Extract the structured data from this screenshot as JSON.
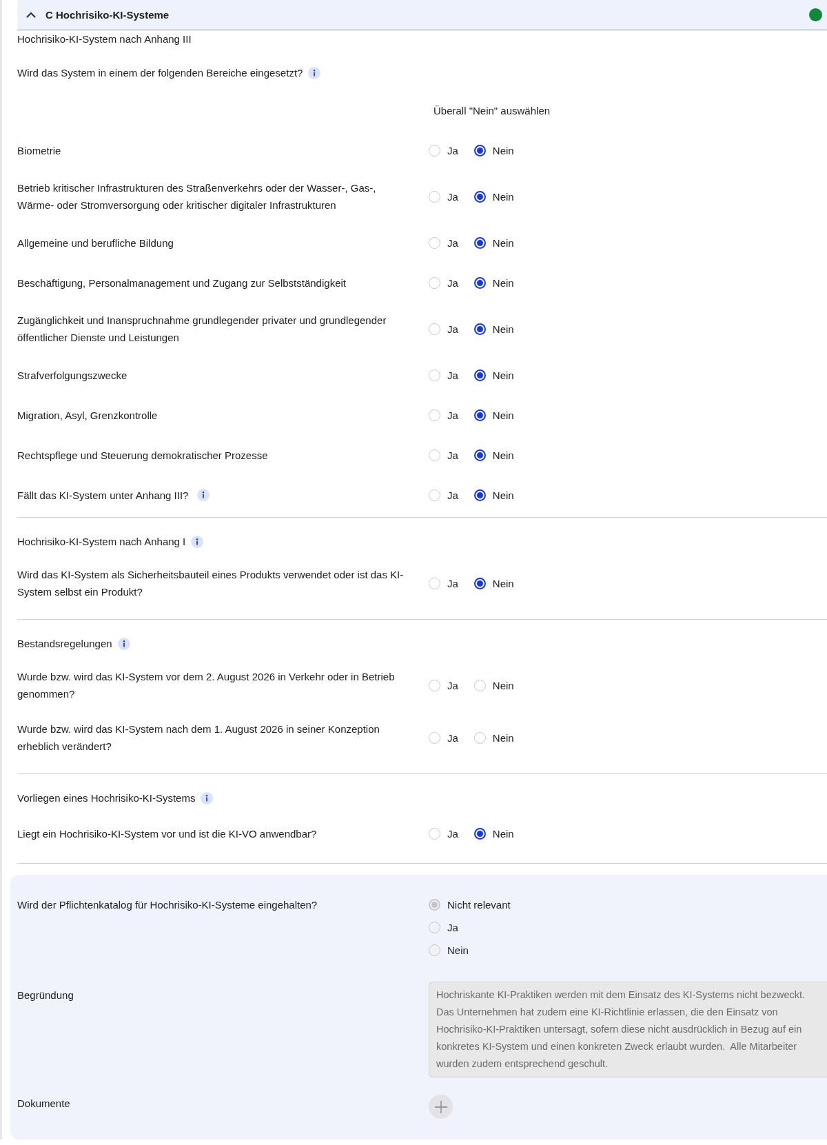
{
  "section": {
    "title": "C Hochrisiko-KI-Systeme",
    "expanded": true,
    "color": "#12883e"
  },
  "groups": [
    {
      "heading": "Hochrisiko-KI-System nach Anhang III",
      "info": false,
      "intro": {
        "text": "Wird das System in einem der folgenden Bereiche eingesetzt?",
        "info": true
      },
      "select_all_no": "Überall \"Nein\" auswählen",
      "questions": [
        {
          "text": "Biometrie",
          "info": false,
          "options": [
            {
              "label": "Ja",
              "selected": false
            },
            {
              "label": "Nein",
              "selected": true
            }
          ]
        },
        {
          "text": "Betrieb kritischer Infrastrukturen des Straßenverkehrs oder der Wasser-, Gas-, Wärme- oder Stromversorgung oder kritischer digitaler Infrastrukturen",
          "info": false,
          "options": [
            {
              "label": "Ja",
              "selected": false
            },
            {
              "label": "Nein",
              "selected": true
            }
          ]
        },
        {
          "text": "Allgemeine und berufliche Bildung",
          "info": false,
          "options": [
            {
              "label": "Ja",
              "selected": false
            },
            {
              "label": "Nein",
              "selected": true
            }
          ]
        },
        {
          "text": "Beschäftigung, Personalmanagement und Zugang zur Selbstständigkeit",
          "info": false,
          "options": [
            {
              "label": "Ja",
              "selected": false
            },
            {
              "label": "Nein",
              "selected": true
            }
          ]
        },
        {
          "text": "Zugänglichkeit und Inanspruchnahme grundlegender privater und grundlegender öffentlicher Dienste und Leistungen",
          "info": false,
          "options": [
            {
              "label": "Ja",
              "selected": false
            },
            {
              "label": "Nein",
              "selected": true
            }
          ]
        },
        {
          "text": "Strafverfolgungszwecke",
          "info": false,
          "options": [
            {
              "label": "Ja",
              "selected": false
            },
            {
              "label": "Nein",
              "selected": true
            }
          ]
        },
        {
          "text": "Migration, Asyl, Grenzkontrolle",
          "info": false,
          "options": [
            {
              "label": "Ja",
              "selected": false
            },
            {
              "label": "Nein",
              "selected": true
            }
          ]
        },
        {
          "text": "Rechtspflege und Steuerung demokratischer Prozesse",
          "info": false,
          "options": [
            {
              "label": "Ja",
              "selected": false
            },
            {
              "label": "Nein",
              "selected": true
            }
          ]
        },
        {
          "text": "Fällt das KI-System unter Anhang III?",
          "info": true,
          "options": [
            {
              "label": "Ja",
              "selected": false
            },
            {
              "label": "Nein",
              "selected": true
            }
          ]
        }
      ]
    },
    {
      "heading": "Hochrisiko-KI-System nach Anhang I",
      "info": true,
      "questions": [
        {
          "text": "Wird das KI-System als Sicherheitsbauteil eines Produkts verwendet oder ist das KI-System selbst ein Produkt?",
          "info": false,
          "options": [
            {
              "label": "Ja",
              "selected": false
            },
            {
              "label": "Nein",
              "selected": true
            }
          ]
        }
      ]
    },
    {
      "heading": "Bestandsregelungen",
      "info": true,
      "questions": [
        {
          "text": "Wurde bzw. wird das KI-System vor dem 2. August 2026 in Verkehr oder in Betrieb genommen?",
          "info": false,
          "options": [
            {
              "label": "Ja",
              "selected": false
            },
            {
              "label": "Nein",
              "selected": false
            }
          ]
        },
        {
          "text": "Wurde bzw. wird das KI-System nach dem 1. August 2026 in seiner Konzeption erheblich verändert?",
          "info": false,
          "options": [
            {
              "label": "Ja",
              "selected": false
            },
            {
              "label": "Nein",
              "selected": false
            }
          ]
        }
      ]
    },
    {
      "heading": "Vorliegen eines Hochrisiko-KI-Systems",
      "info": true,
      "questions": [
        {
          "text": "Liegt ein Hochrisiko-KI-System vor und ist die KI-VO anwendbar?",
          "info": false,
          "options": [
            {
              "label": "Ja",
              "selected": false
            },
            {
              "label": "Nein",
              "selected": true
            }
          ]
        }
      ]
    }
  ],
  "compliance": {
    "question": "Wird der Pflichtenkatalog für Hochrisiko-KI-Systeme eingehalten?",
    "options": [
      {
        "label": "Nicht relevant",
        "selected": true,
        "disabled": true
      },
      {
        "label": "Ja",
        "selected": false,
        "disabled": true
      },
      {
        "label": "Nein",
        "selected": false,
        "disabled": true
      }
    ],
    "reason": {
      "label": "Begründung",
      "value": "Hochriskante KI-Praktiken werden mit dem Einsatz des KI-Systems nicht bezweckt. Das Unternehmen hat zudem eine KI-Richtlinie erlassen, die den Einsatz von Hochrisiko-KI-Praktiken untersagt, sofern diese nicht ausdrücklich in Bezug auf ein konkretes KI-System und einen konkreten Zweck erlaubt wurden.  Alle Mitarbeiter wurden zudem entsprechend geschult.",
      "disabled": true
    },
    "documents": {
      "label": "Dokumente",
      "disabled": true
    }
  }
}
